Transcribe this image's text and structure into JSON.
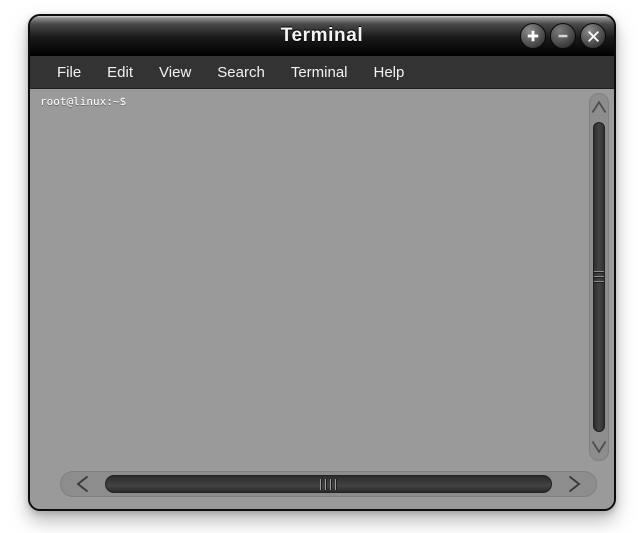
{
  "window": {
    "title": "Terminal",
    "accent_color": "#9a9a9a",
    "titlebar_color": "#000000",
    "menubar_color": "#333333"
  },
  "titlebar_buttons": [
    {
      "name": "maximize",
      "icon": "plus-icon",
      "glyph": "+"
    },
    {
      "name": "minimize",
      "icon": "minus-icon",
      "glyph": "−"
    },
    {
      "name": "close",
      "icon": "close-icon",
      "glyph": "×"
    }
  ],
  "menubar": {
    "items": [
      {
        "label": "File"
      },
      {
        "label": "Edit"
      },
      {
        "label": "View"
      },
      {
        "label": "Search"
      },
      {
        "label": "Terminal"
      },
      {
        "label": "Help"
      }
    ]
  },
  "terminal": {
    "prompt": "root@linux:~$",
    "background_color": "#9a9a9a",
    "text_color": "#ffffff",
    "lines": [
      "root@linux:~$"
    ]
  },
  "scrollbars": {
    "vertical": {
      "up_arrow_icon": "chevron-up-icon",
      "down_arrow_icon": "chevron-down-icon",
      "thumb_grip_lines": 3
    },
    "horizontal": {
      "left_arrow_icon": "chevron-left-icon",
      "right_arrow_icon": "chevron-right-icon",
      "thumb_grip_lines": 4
    }
  }
}
